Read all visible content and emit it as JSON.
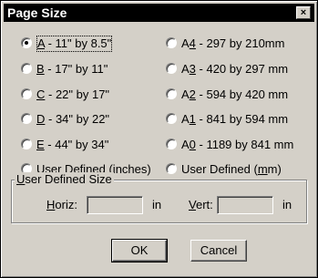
{
  "dialog": {
    "title": "Page Size",
    "close_glyph": "×"
  },
  "options_left": [
    {
      "key": "A",
      "rest": " - 11\" by 8.5\"",
      "checked": true
    },
    {
      "key": "B",
      "rest": " - 17\" by 11\"",
      "checked": false
    },
    {
      "key": "C",
      "rest": " - 22\" by 17\"",
      "checked": false
    },
    {
      "key": "D",
      "rest": " - 34\" by 22\"",
      "checked": false
    },
    {
      "key": "E",
      "rest": " - 44\" by 34\"",
      "checked": false
    },
    {
      "key": "U",
      "rest": "ser Defined (inches)",
      "checked": false
    }
  ],
  "options_right": [
    {
      "pre": "A",
      "key": "4",
      "rest": " - 297 by 210mm",
      "checked": false
    },
    {
      "pre": "A",
      "key": "3",
      "rest": " - 420 by 297 mm",
      "checked": false
    },
    {
      "pre": "A",
      "key": "2",
      "rest": " - 594 by 420 mm",
      "checked": false
    },
    {
      "pre": "A",
      "key": "1",
      "rest": " - 841 by 594 mm",
      "checked": false
    },
    {
      "pre": "A",
      "key": "0",
      "rest": " - 1189 by 841 mm",
      "checked": false
    },
    {
      "pre": "User Defined (",
      "key": "m",
      "rest": "m)",
      "checked": false
    }
  ],
  "user_defined": {
    "group_key": "U",
    "group_rest": "ser Defined Size",
    "horiz_key": "H",
    "horiz_rest": "oriz:",
    "horiz_value": "",
    "horiz_unit": "in",
    "vert_key": "V",
    "vert_rest": "ert:",
    "vert_value": "",
    "vert_unit": "in"
  },
  "buttons": {
    "ok": "OK",
    "cancel": "Cancel"
  }
}
